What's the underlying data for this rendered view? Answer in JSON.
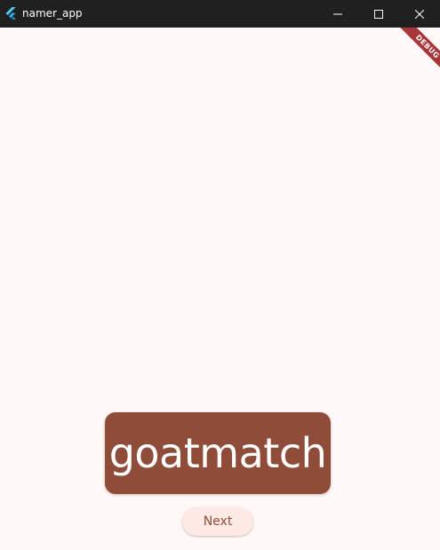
{
  "window": {
    "title": "namer_app",
    "controls": {
      "minimize_icon": "minimize-icon",
      "maximize_icon": "maximize-icon",
      "close_icon": "close-icon"
    }
  },
  "main": {
    "word": "goatmatch",
    "next_label": "Next"
  },
  "debug_banner": {
    "label": "DEBUG"
  },
  "colors": {
    "background": "#fff8f6",
    "titlebar": "#202020",
    "card": "#8f4c38",
    "button_bg": "#fdeae4",
    "button_text": "#8f4c38",
    "debug_ribbon": "#a8353a"
  }
}
